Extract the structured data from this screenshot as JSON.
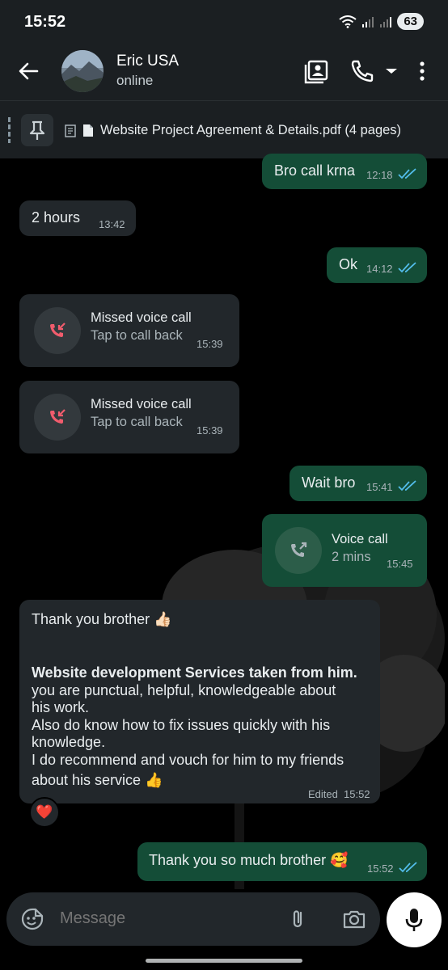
{
  "status_bar": {
    "time": "15:52",
    "battery": "63"
  },
  "header": {
    "contact_name": "Eric USA",
    "contact_status": "online"
  },
  "pinned": {
    "document_title": "Website Project Agreement & Details.pdf (4 pages)"
  },
  "messages": [
    {
      "type": "text",
      "direction": "out",
      "text": "Bro call krna",
      "time": "12:18",
      "read": true
    },
    {
      "type": "text",
      "direction": "in",
      "text": "2 hours",
      "time": "13:42"
    },
    {
      "type": "text",
      "direction": "out",
      "text": "Ok",
      "time": "14:12",
      "read": true
    },
    {
      "type": "call",
      "direction": "in",
      "title": "Missed voice call",
      "subtitle": "Tap to call back",
      "time": "15:39"
    },
    {
      "type": "call",
      "direction": "in",
      "title": "Missed voice call",
      "subtitle": "Tap to call back",
      "time": "15:39"
    },
    {
      "type": "text",
      "direction": "out",
      "text": "Wait bro",
      "time": "15:41",
      "read": true
    },
    {
      "type": "call",
      "direction": "out",
      "title": "Voice call",
      "subtitle": "2 mins",
      "time": "15:45"
    },
    {
      "type": "long",
      "direction": "in",
      "line1": "Thank you brother 👍🏻",
      "bold_line": "Website development Services taken from him.",
      "body_lines": [
        "you are  punctual, helpful, knowledgeable about",
        "his work.",
        "Also do know how to fix issues quickly with his",
        "knowledge.",
        "I do recommend and vouch for him to my friends",
        "about his service 👍"
      ],
      "edited_label": "Edited",
      "time": "15:52",
      "reaction": "❤️"
    },
    {
      "type": "text",
      "direction": "out",
      "text": "Thank you so much brother 🥰",
      "time": "15:52",
      "read": true
    }
  ],
  "composer": {
    "placeholder": "Message"
  },
  "colors": {
    "incoming_bubble": "#22272b",
    "outgoing_bubble": "#144d37",
    "read_ticks": "#53bdeb",
    "missed_call": "#f15c6d"
  }
}
